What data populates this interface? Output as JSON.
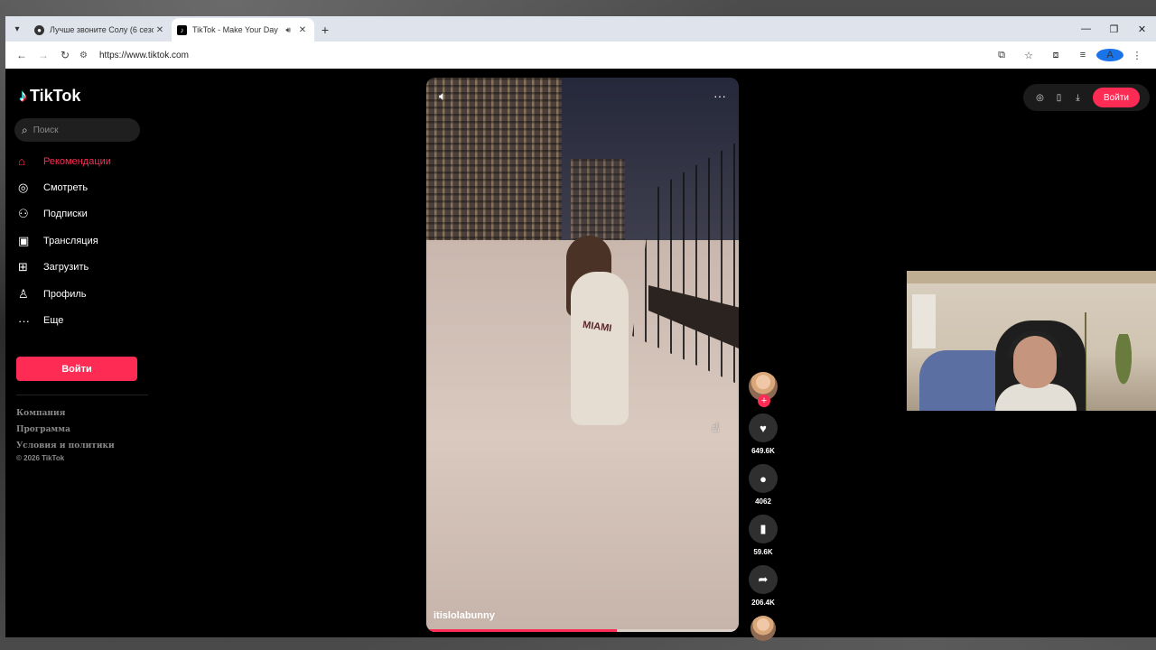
{
  "browser": {
    "tabs": [
      {
        "title": "Лучше звоните Солу (6 сезон)",
        "active": false
      },
      {
        "title": "TikTok - Make Your Day",
        "active": true
      }
    ],
    "url": "https://www.tiktok.com"
  },
  "sidebar": {
    "logo": "TikTok",
    "search_placeholder": "Поиск",
    "items": [
      {
        "label": "Рекомендации",
        "icon": "home-icon",
        "active": true
      },
      {
        "label": "Смотреть",
        "icon": "compass-icon",
        "active": false
      },
      {
        "label": "Подписки",
        "icon": "following-icon",
        "active": false
      },
      {
        "label": "Трансляция",
        "icon": "live-icon",
        "active": false
      },
      {
        "label": "Загрузить",
        "icon": "upload-icon",
        "active": false
      },
      {
        "label": "Профиль",
        "icon": "profile-icon",
        "active": false
      },
      {
        "label": "Еще",
        "icon": "more-icon",
        "active": false
      }
    ],
    "login_label": "Войти",
    "footer": [
      "Компания",
      "Программа",
      "Условия и политики",
      "© 2026 TikTok"
    ]
  },
  "top_actions": {
    "login_label": "Войти"
  },
  "video": {
    "author": "itislolabunny",
    "overlay_text": "MIAMI",
    "progress": 0.61,
    "likes": "649.6K",
    "comments": "4062",
    "saves": "59.6K",
    "shares": "206.4K"
  },
  "colors": {
    "accent": "#fe2c55",
    "background": "#000000"
  }
}
